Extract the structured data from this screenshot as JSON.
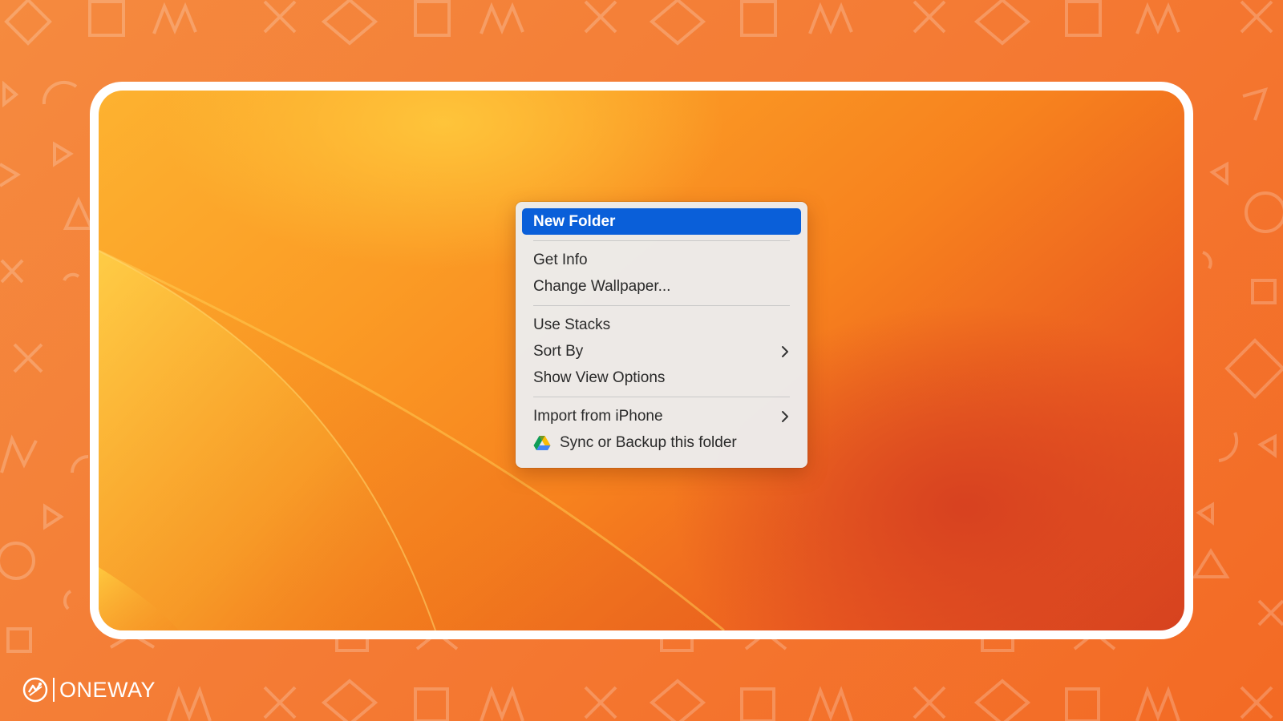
{
  "context_menu": {
    "items": [
      {
        "label": "New Folder"
      },
      {
        "label": "Get Info"
      },
      {
        "label": "Change Wallpaper..."
      },
      {
        "label": "Use Stacks"
      },
      {
        "label": "Sort By"
      },
      {
        "label": "Show View Options"
      },
      {
        "label": "Import from iPhone"
      },
      {
        "label": "Sync or Backup this folder",
        "icon": "google-drive-icon"
      }
    ],
    "highlighted_item": "New Folder"
  },
  "brand": {
    "name": "ONEWAY",
    "icon": "oneway-logo-icon"
  },
  "colors": {
    "background_orange": "#f47c35",
    "frame": "#ffffff",
    "menu_highlight": "#0a5fd9",
    "menu_background": "#ececec",
    "wallpaper_light": "#fdb230",
    "wallpaper_deep": "#d6421f"
  }
}
